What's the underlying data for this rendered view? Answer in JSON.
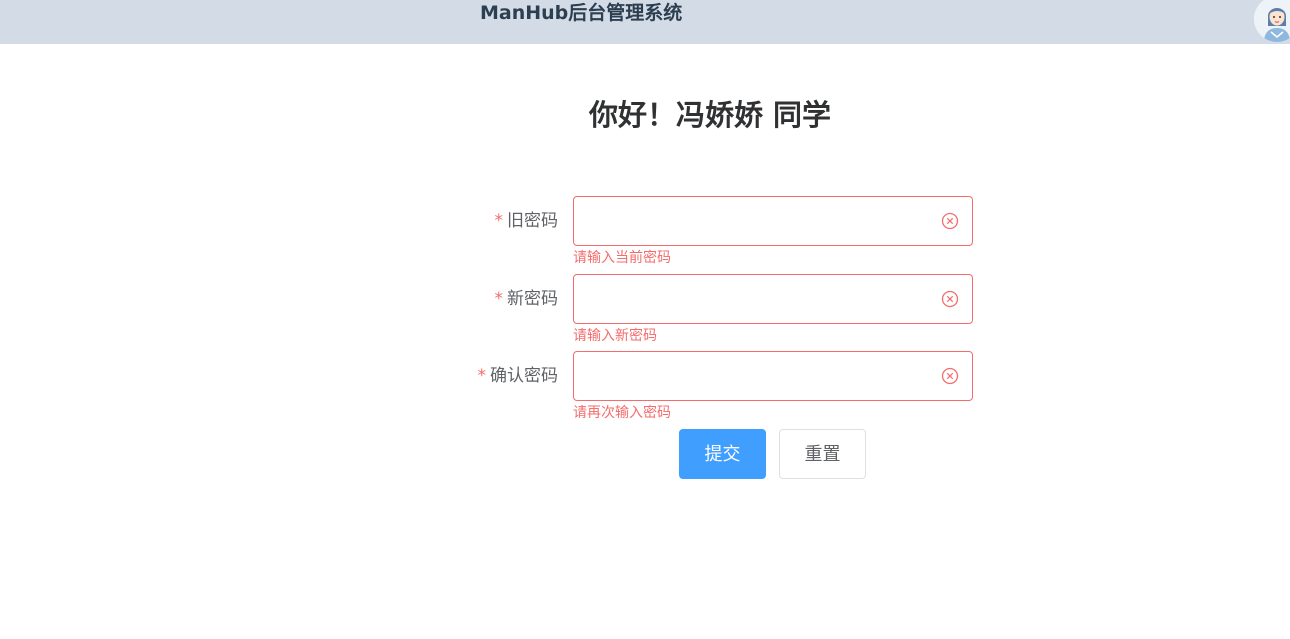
{
  "header": {
    "title": "ManHub后台管理系统",
    "avatar_icon": "user-avatar-icon"
  },
  "greeting": "你好！冯娇娇 同学",
  "form": {
    "required_mark": "*",
    "fields": [
      {
        "label": "旧密码",
        "value": "",
        "error": "请输入当前密码",
        "clear_icon": "circle-close-icon"
      },
      {
        "label": "新密码",
        "value": "",
        "error": "请输入新密码",
        "clear_icon": "circle-close-icon"
      },
      {
        "label": "确认密码",
        "value": "",
        "error": "请再次输入密码",
        "clear_icon": "circle-close-icon"
      }
    ],
    "submit_label": "提交",
    "reset_label": "重置"
  },
  "colors": {
    "header_bg": "#d3dce6",
    "primary": "#409eff",
    "danger": "#f56c6c"
  }
}
